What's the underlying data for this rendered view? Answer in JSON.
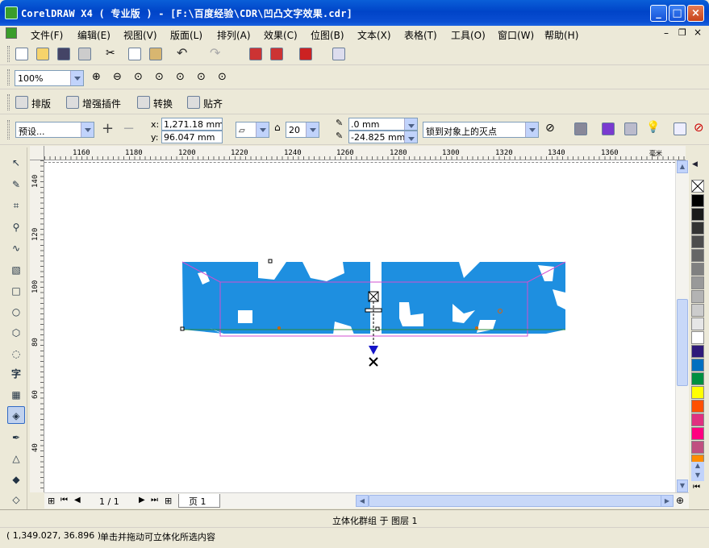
{
  "window": {
    "title": "CorelDRAW X4 ( 专业版 ) - [F:\\百度经验\\CDR\\凹凸文字效果.cdr]"
  },
  "menu": [
    "文件(F)",
    "编辑(E)",
    "视图(V)",
    "版面(L)",
    "排列(A)",
    "效果(C)",
    "位图(B)",
    "文本(X)",
    "表格(T)",
    "工具(O)",
    "窗口(W)",
    "帮助(H)"
  ],
  "zoom": {
    "value": "100%"
  },
  "plugin_bar": {
    "items": [
      "排版",
      "增强插件",
      "转换",
      "贴齐"
    ]
  },
  "property_bar": {
    "preset": "预设...",
    "x_label": "x:",
    "x": "1,271.18 mm",
    "y_label": "y:",
    "y": "96.047 mm",
    "depth": "20",
    "vp_x": ".0 mm",
    "vp_y": "-24.825 mm",
    "vp_lock": "锁到对象上的灭点"
  },
  "ruler": {
    "unit": "毫米",
    "h_ticks": [
      "1160",
      "1180",
      "1200",
      "1220",
      "1240",
      "1260",
      "1280",
      "1300",
      "1320",
      "1340",
      "1360"
    ],
    "v_ticks": [
      "140",
      "120",
      "100",
      "80",
      "60",
      "40"
    ]
  },
  "page_nav": {
    "count": "1 / 1",
    "tab": "页 1"
  },
  "status": {
    "object_info": "立体化群组 于 图层 1",
    "coords": "( 1,349.027, 36.896 )",
    "hint": "单击并拖动可立体化所选内容"
  },
  "palette": [
    "#ffffff",
    "#000000",
    "#1a1a1a",
    "#333333",
    "#4d4d4d",
    "#666666",
    "#808080",
    "#999999",
    "#b3b3b3",
    "#cccccc",
    "#e6e6e6",
    "#ffffff",
    "#2e1a7a",
    "#0070c0",
    "#009040",
    "#ffff00",
    "#ff5000",
    "#e03080",
    "#ff0080",
    "#c05080",
    "#ff8c00",
    "#f08080"
  ],
  "colors": {
    "fill": "#1e8fe0",
    "titlebar": "#0a4ed2"
  }
}
